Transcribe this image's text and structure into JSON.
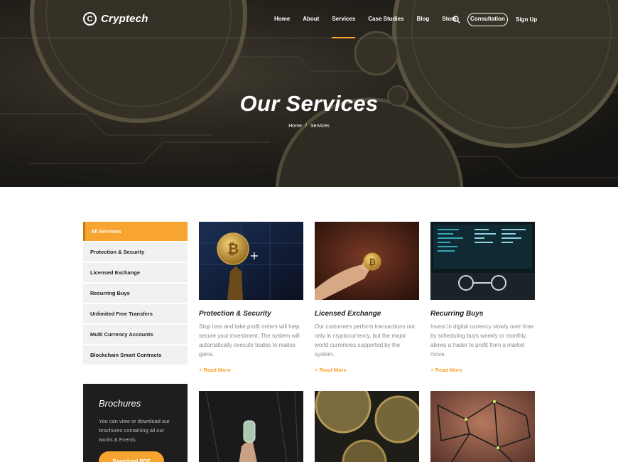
{
  "brand": {
    "name": "Cryptech",
    "mark": "C"
  },
  "nav": {
    "items": [
      "Home",
      "About",
      "Services",
      "Case Studies",
      "Blog",
      "Store"
    ],
    "active": "Services",
    "consultation": "Consultation",
    "signup": "Sign Up"
  },
  "hero": {
    "title": "Our Services",
    "breadcrumb": {
      "home": "Home",
      "separator": "/",
      "current": "Services"
    }
  },
  "sidebar": {
    "items": [
      "All Services",
      "Protection & Security",
      "Licensed Exchange",
      "Recurring Buys",
      "Unlimited Free Transfers",
      "Multi Currency Accounts",
      "Blockchain Smart Contracts"
    ],
    "active_index": 0
  },
  "brochure": {
    "title": "Brochures",
    "text": "You can view or download our brochures containing all our works & Events.",
    "button": "Download PDF"
  },
  "cards": [
    {
      "title": "Protection & Security",
      "text": "Stop loss and take profit orders will help secure your investment. The system will automatically execute trades to realise gains.",
      "link": "Read More"
    },
    {
      "title": "Licensed Exchange",
      "text": "Our customers perform transactions not only in cryptocurrency, but the major world currencies supported by the system.",
      "link": "Read More"
    },
    {
      "title": "Recurring Buys",
      "text": "Invest in digital currency slowly over time by scheduling buys weekly or monthly, allows a trader to profit from a market move.",
      "link": "Read More"
    }
  ],
  "colors": {
    "accent": "#f7a530",
    "dark": "#1e1e1e",
    "sidebar_bg": "#f1f1f1"
  },
  "icons": [
    "search-icon",
    "plus-icon",
    "bitcoin-icon"
  ]
}
